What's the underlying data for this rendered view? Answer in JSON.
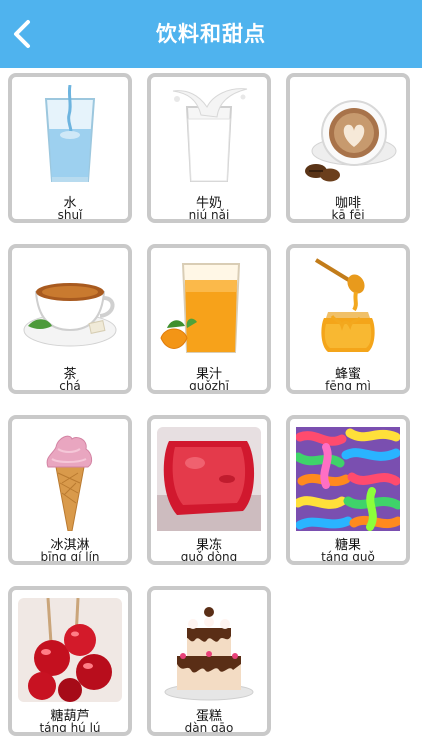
{
  "header": {
    "title": "饮料和甜点",
    "back_icon": "chevron-left-icon",
    "color": "#4fb3ee"
  },
  "items": [
    {
      "hanzi": "水",
      "pinyin": "shuǐ",
      "icon": "water-glass-icon"
    },
    {
      "hanzi": "牛奶",
      "pinyin": "niú nǎi",
      "icon": "milk-glass-icon"
    },
    {
      "hanzi": "咖啡",
      "pinyin": "kā fēi",
      "icon": "coffee-cup-icon"
    },
    {
      "hanzi": "茶",
      "pinyin": "chá",
      "icon": "tea-cup-icon"
    },
    {
      "hanzi": "果汁",
      "pinyin": "guǒzhī",
      "icon": "juice-glass-icon"
    },
    {
      "hanzi": "蜂蜜",
      "pinyin": "fēng mì",
      "icon": "honey-jar-icon"
    },
    {
      "hanzi": "冰淇淋",
      "pinyin": "bīng qí lín",
      "icon": "ice-cream-icon"
    },
    {
      "hanzi": "果冻",
      "pinyin": "guǒ dòng",
      "icon": "jelly-icon"
    },
    {
      "hanzi": "糖果",
      "pinyin": "táng guǒ",
      "icon": "candy-icon"
    },
    {
      "hanzi": "糖葫芦",
      "pinyin": "táng hú lú",
      "icon": "candied-haws-icon"
    },
    {
      "hanzi": "蛋糕",
      "pinyin": "dàn gāo",
      "icon": "cake-icon"
    }
  ]
}
